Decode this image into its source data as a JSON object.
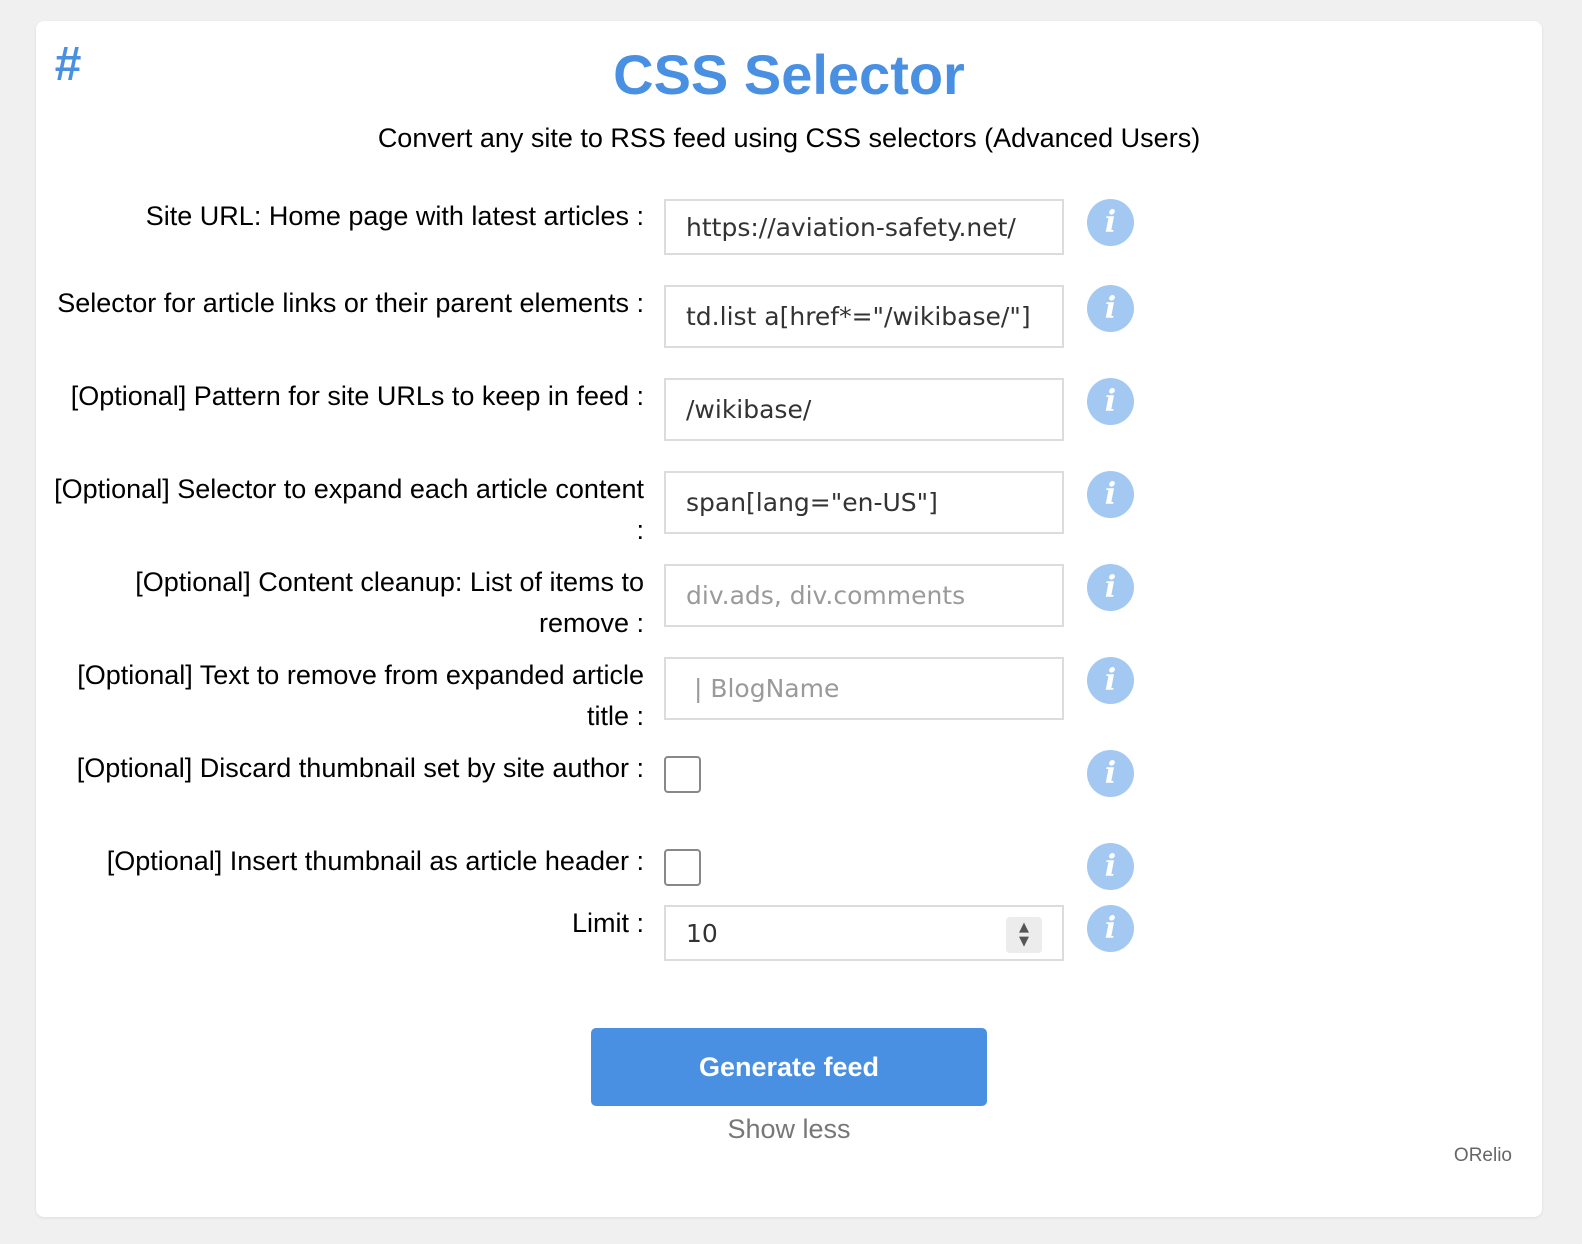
{
  "header": {
    "hash_icon": "#",
    "title": "CSS Selector",
    "subtitle": "Convert any site to RSS feed using CSS selectors (Advanced Users)"
  },
  "form": {
    "site_url": {
      "label": "Site URL: Home page with latest articles :",
      "value": "https://aviation-safety.net/"
    },
    "link_selector": {
      "label": "Selector for article links or their parent elements :",
      "value": "td.list a[href*=\"/wikibase/\"]"
    },
    "url_pattern": {
      "label": "[Optional] Pattern for site URLs to keep in feed :",
      "value": "/wikibase/"
    },
    "expand_selector": {
      "label": "[Optional] Selector to expand each article content :",
      "value": "span[lang=\"en-US\"]"
    },
    "cleanup": {
      "label": "[Optional] Content cleanup: List of items to remove :",
      "placeholder": "div.ads, div.comments"
    },
    "title_remove": {
      "label": "[Optional] Text to remove from expanded article title :",
      "placeholder": " | BlogName"
    },
    "discard_thumbnail": {
      "label": "[Optional] Discard thumbnail set by site author :",
      "checked": false
    },
    "insert_thumbnail": {
      "label": "[Optional] Insert thumbnail as article header :",
      "checked": false
    },
    "limit": {
      "label": "Limit :",
      "value": "10"
    },
    "info_icon": "i"
  },
  "actions": {
    "generate_label": "Generate feed",
    "show_less_label": "Show less"
  },
  "footer": {
    "credit": "ORelio"
  },
  "colors": {
    "accent": "#4a90e2",
    "info": "#a3c8f2"
  }
}
